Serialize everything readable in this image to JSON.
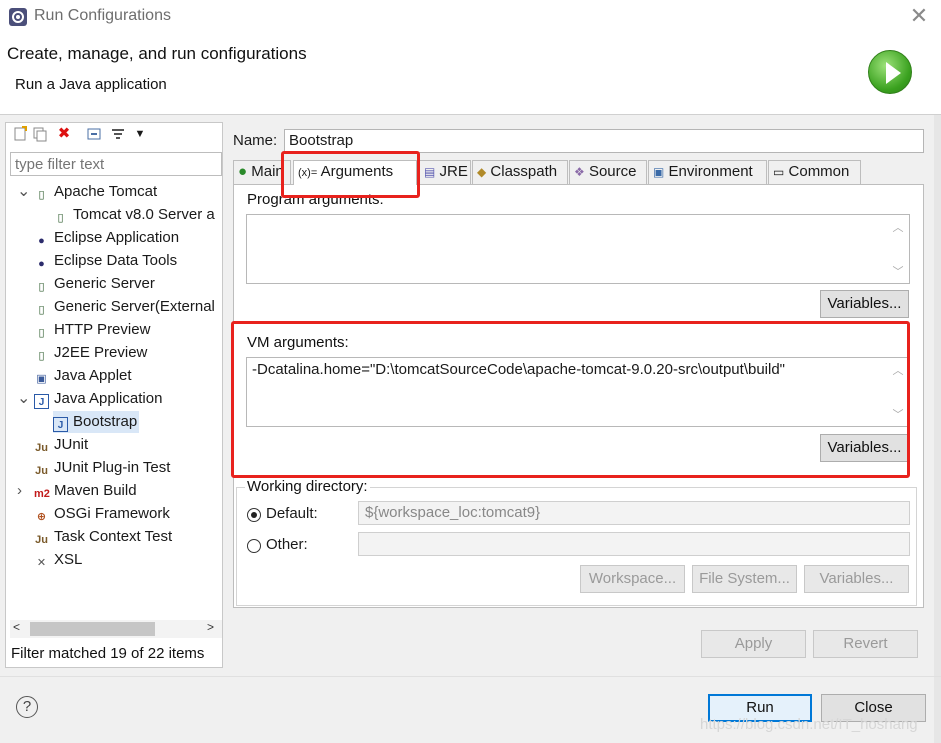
{
  "window": {
    "title": "Run Configurations",
    "close_glyph": "✕"
  },
  "header": {
    "heading": "Create, manage, and run configurations",
    "subheading": "Run a Java application"
  },
  "left": {
    "toolbar_icons": [
      "new-config-icon",
      "duplicate-icon",
      "delete-icon",
      "collapse-all-icon",
      "filter-icon",
      "menu-dropdown-icon"
    ],
    "filter_placeholder": "type filter text",
    "tree": [
      {
        "label": "Apache Tomcat",
        "icon": "tomcat-icon",
        "expanded": true,
        "level": 0
      },
      {
        "label": "Tomcat v8.0 Server a",
        "icon": "server-icon",
        "level": 1
      },
      {
        "label": "Eclipse Application",
        "icon": "eclipse-icon",
        "level": 0
      },
      {
        "label": "Eclipse Data Tools",
        "icon": "datatools-icon",
        "level": 0
      },
      {
        "label": "Generic Server",
        "icon": "server-icon",
        "level": 0
      },
      {
        "label": "Generic Server(External",
        "icon": "server-icon",
        "level": 0
      },
      {
        "label": "HTTP Preview",
        "icon": "server-icon",
        "level": 0
      },
      {
        "label": "J2EE Preview",
        "icon": "server-icon",
        "level": 0
      },
      {
        "label": "Java Applet",
        "icon": "applet-icon",
        "level": 0
      },
      {
        "label": "Java Application",
        "icon": "java-app-icon",
        "expanded": true,
        "level": 0
      },
      {
        "label": "Bootstrap",
        "icon": "java-app-icon",
        "level": 1,
        "selected": true
      },
      {
        "label": "JUnit",
        "icon": "junit-icon",
        "level": 0
      },
      {
        "label": "JUnit Plug-in Test",
        "icon": "junit-plugin-icon",
        "level": 0
      },
      {
        "label": "Maven Build",
        "icon": "maven-icon",
        "collapsed": true,
        "level": 0
      },
      {
        "label": "OSGi Framework",
        "icon": "osgi-icon",
        "level": 0
      },
      {
        "label": "Task Context Test",
        "icon": "junit-icon",
        "level": 0
      },
      {
        "label": "XSL",
        "icon": "xsl-icon",
        "level": 0
      }
    ],
    "filter_status": "Filter matched 19 of 22 items"
  },
  "right": {
    "name_label": "Name:",
    "name_value": "Bootstrap",
    "tabs": [
      {
        "label": "Main",
        "icon": "main-tab-icon"
      },
      {
        "label": "Arguments",
        "icon": "arguments-tab-icon",
        "active": true
      },
      {
        "label": "JRE",
        "icon": "jre-tab-icon"
      },
      {
        "label": "Classpath",
        "icon": "classpath-tab-icon"
      },
      {
        "label": "Source",
        "icon": "source-tab-icon"
      },
      {
        "label": "Environment",
        "icon": "environment-tab-icon"
      },
      {
        "label": "Common",
        "icon": "common-tab-icon"
      }
    ],
    "program_args_label": "Program arguments:",
    "program_args_value": "",
    "variables_label": "Variables...",
    "vm_args_label": "VM arguments:",
    "vm_args_value": "-Dcatalina.home=\"D:\\tomcatSourceCode\\apache-tomcat-9.0.20-src\\output\\build\"",
    "working_dir_label": "Working directory:",
    "default_label": "Default:",
    "default_value": "${workspace_loc:tomcat9}",
    "other_label": "Other:",
    "other_value": "",
    "workspace_btn": "Workspace...",
    "filesystem_btn": "File System...",
    "apply_btn": "Apply",
    "revert_btn": "Revert"
  },
  "footer": {
    "help_glyph": "?",
    "run_btn": "Run",
    "close_btn": "Close",
    "watermark": "https://blog.csdn.net/IT_hoshang"
  },
  "colors": {
    "highlight": "#e8221d",
    "selection": "#d9e7f7",
    "run_green": "#3aa11f"
  }
}
